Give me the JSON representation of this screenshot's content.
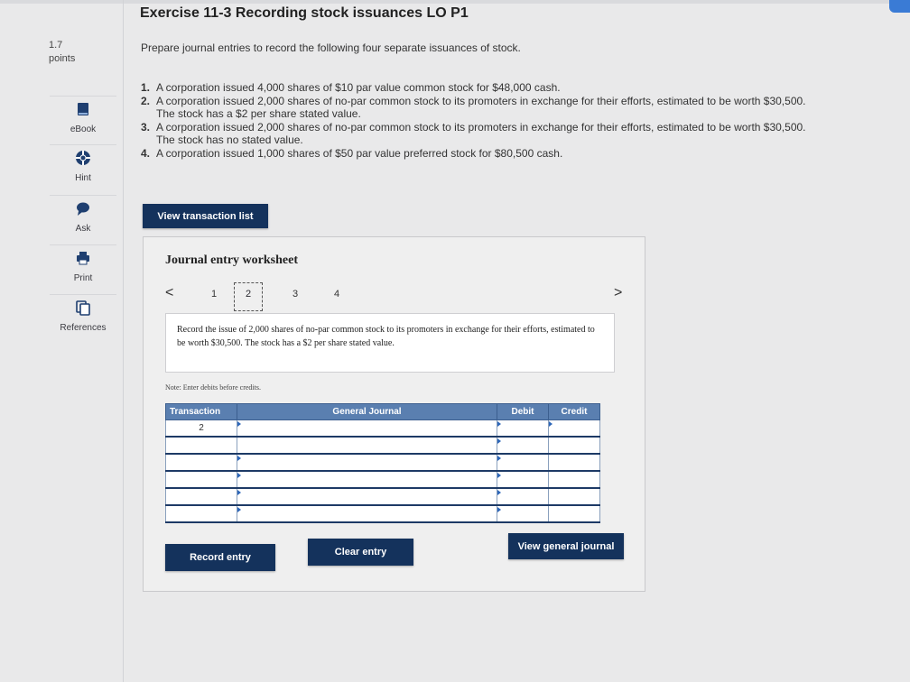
{
  "header": {
    "title": "Exercise 11-3 Recording stock issuances LO P1"
  },
  "score": {
    "value": "1.7",
    "label": "points"
  },
  "toolbar": [
    {
      "label": "eBook",
      "icon": "book-icon"
    },
    {
      "label": "Hint",
      "icon": "lifebuoy-icon"
    },
    {
      "label": "Ask",
      "icon": "chat-bubble-icon"
    },
    {
      "label": "Print",
      "icon": "printer-icon"
    },
    {
      "label": "References",
      "icon": "documents-icon"
    }
  ],
  "problem": {
    "prompt": "Prepare journal entries to record the following four separate issuances of stock.",
    "items": [
      {
        "num": "1.",
        "text": "A corporation issued 4,000 shares of $10 par value common stock for $48,000 cash."
      },
      {
        "num": "2.",
        "text": "A corporation issued 2,000 shares of no-par common stock to its promoters in exchange for their efforts, estimated to be worth $30,500. The stock has a $2 per share stated value."
      },
      {
        "num": "3.",
        "text": "A corporation issued 2,000 shares of no-par common stock to its promoters in exchange for their efforts, estimated to be worth $30,500. The stock has no stated value."
      },
      {
        "num": "4.",
        "text": "A corporation issued 1,000 shares of $50 par value preferred stock for $80,500 cash."
      }
    ]
  },
  "buttons": {
    "view_transactions": "View transaction list",
    "record_entry": "Record entry",
    "clear_entry": "Clear entry",
    "view_general_journal": "View general journal"
  },
  "worksheet": {
    "title": "Journal entry worksheet",
    "pages": [
      "1",
      "2",
      "3",
      "4"
    ],
    "active_page": "2",
    "prev_arrow": "<",
    "next_arrow": ">",
    "description": "Record the issue of 2,000 shares of no-par common stock to its promoters in exchange for their efforts, estimated to be worth $30,500. The stock has a $2 per share stated value.",
    "note": "Note: Enter debits before credits.",
    "table": {
      "headers": [
        "Transaction",
        "General Journal",
        "Debit",
        "Credit"
      ],
      "rows": [
        {
          "transaction": "2"
        },
        {
          "transaction": ""
        },
        {
          "transaction": ""
        },
        {
          "transaction": ""
        },
        {
          "transaction": ""
        },
        {
          "transaction": ""
        }
      ]
    }
  },
  "colors": {
    "button": "#14325c",
    "table_header": "#5a7fb0",
    "background": "#e9e9ea"
  }
}
